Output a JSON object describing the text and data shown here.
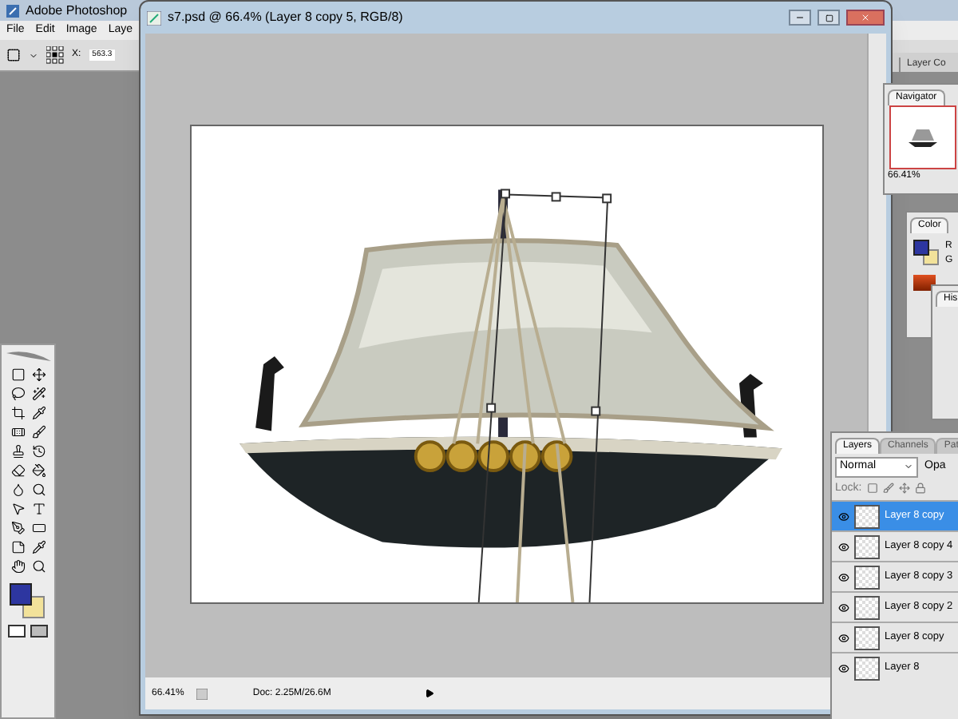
{
  "app": {
    "title": "Adobe Photoshop"
  },
  "menu": [
    "File",
    "Edit",
    "Image",
    "Laye"
  ],
  "options_bar": {
    "x_label": "X:",
    "x_value": "563.3"
  },
  "document": {
    "title": "s7.psd @ 66.4% (Layer 8 copy 5, RGB/8)",
    "zoom": "66.41%",
    "doc_size": "Doc: 2.25M/26.6M"
  },
  "dock_tabs": [
    "Layer Co"
  ],
  "navigator": {
    "tabs": [
      {
        "label": "Navigator",
        "selected": true
      }
    ],
    "zoom": "66.41%"
  },
  "color": {
    "tabs": [
      {
        "label": "Color",
        "selected": true
      }
    ],
    "channels": [
      "R",
      "G"
    ]
  },
  "history": {
    "tabs": [
      {
        "label": "His",
        "selected": true
      }
    ]
  },
  "layers": {
    "tabs": [
      {
        "label": "Layers",
        "selected": true
      },
      {
        "label": "Channels",
        "selected": false
      },
      {
        "label": "Pat",
        "selected": false
      }
    ],
    "blend_mode": "Normal",
    "opacity_label": "Opa",
    "lock_label": "Lock:",
    "rows": [
      {
        "name": "Layer 8 copy",
        "selected": true,
        "visible": true
      },
      {
        "name": "Layer 8 copy 4",
        "selected": false,
        "visible": true
      },
      {
        "name": "Layer 8 copy 3",
        "selected": false,
        "visible": true
      },
      {
        "name": "Layer 8 copy 2",
        "selected": false,
        "visible": true
      },
      {
        "name": "Layer 8 copy",
        "selected": false,
        "visible": true
      },
      {
        "name": "Layer 8",
        "selected": false,
        "visible": true
      }
    ]
  }
}
